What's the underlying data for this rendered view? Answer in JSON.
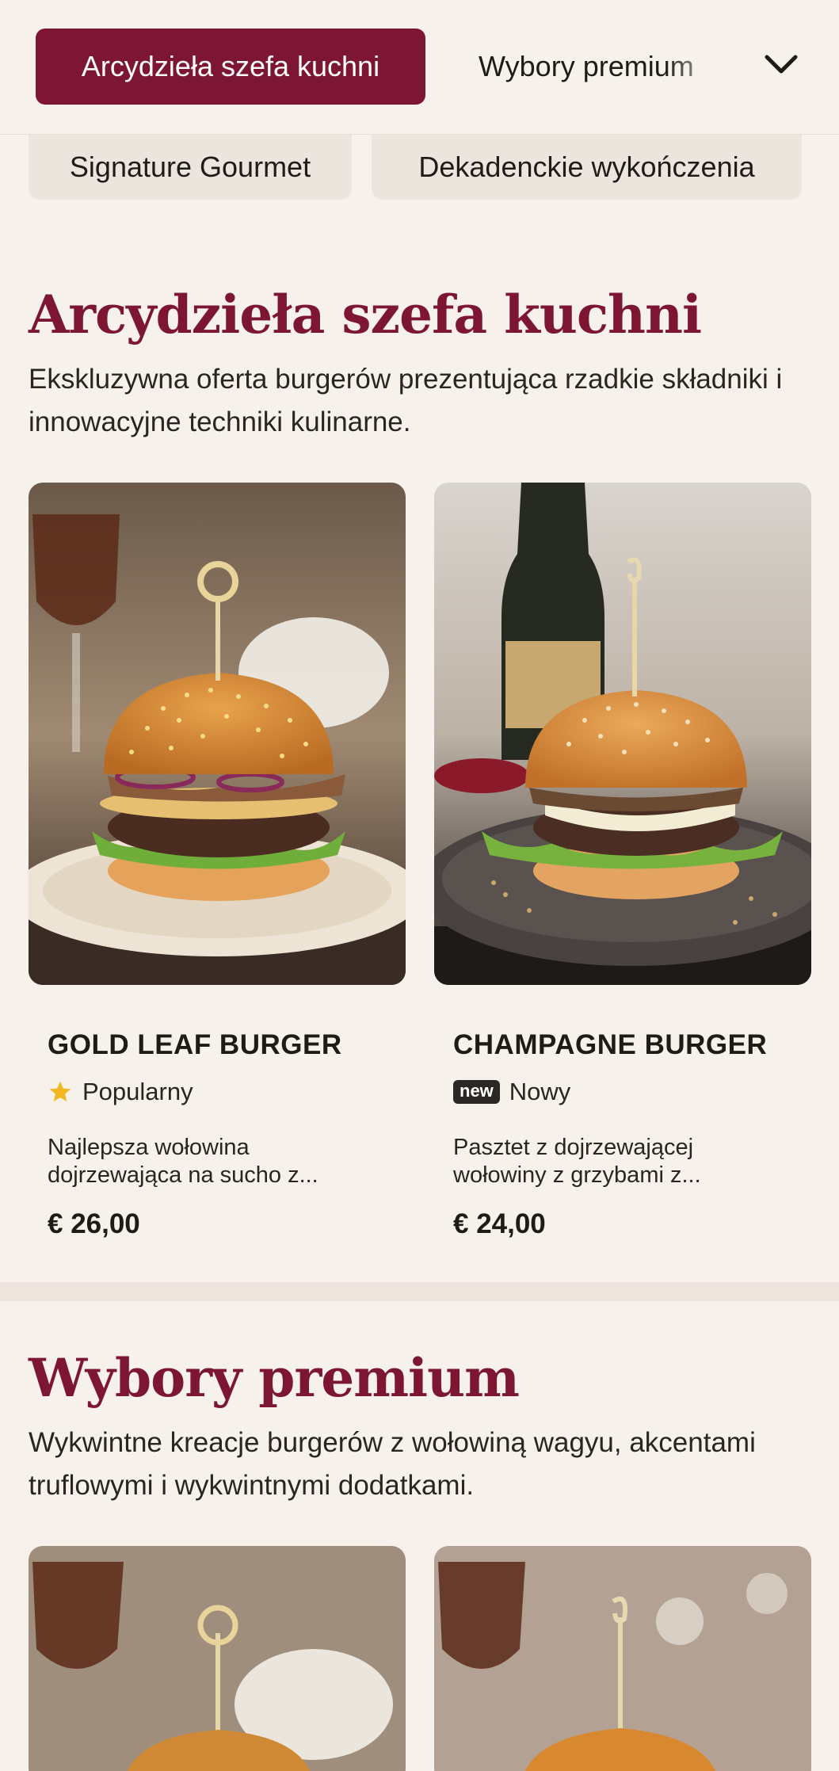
{
  "tabs": {
    "active_label": "Arcydzieła szefa kuchni",
    "next_label": "Wybory premium",
    "expand_icon": "chevron-down-icon"
  },
  "chips": [
    "Signature Gourmet",
    "Dekadenckie wykończenia"
  ],
  "sections": [
    {
      "title": "Arcydzieła szefa kuchni",
      "description": "Ekskluzywna oferta burgerów prezentująca rzadkie składniki i innowacyjne techniki kulinarne.",
      "items": [
        {
          "name": "GOLD LEAF BURGER",
          "badge_icon": "star-icon",
          "badge_label": "Popularny",
          "description": "Najlepsza wołowina dojrzewająca na sucho z...",
          "price": "€ 26,00"
        },
        {
          "name": "CHAMPAGNE BURGER",
          "badge_icon": "new-tag-icon",
          "badge_tag": "new",
          "badge_label": "Nowy",
          "description": "Pasztet z dojrzewającej wołowiny z grzybami z...",
          "price": "€ 24,00"
        }
      ]
    },
    {
      "title": "Wybory premium",
      "description": "Wykwintne kreacje burgerów z wołowiną wagyu, akcentami truflowymi i wykwintnymi dodatkami."
    }
  ],
  "colors": {
    "brand": "#7d1534",
    "background": "#f6f2eb",
    "chip": "#ebe5dd",
    "star": "#f2b824"
  }
}
